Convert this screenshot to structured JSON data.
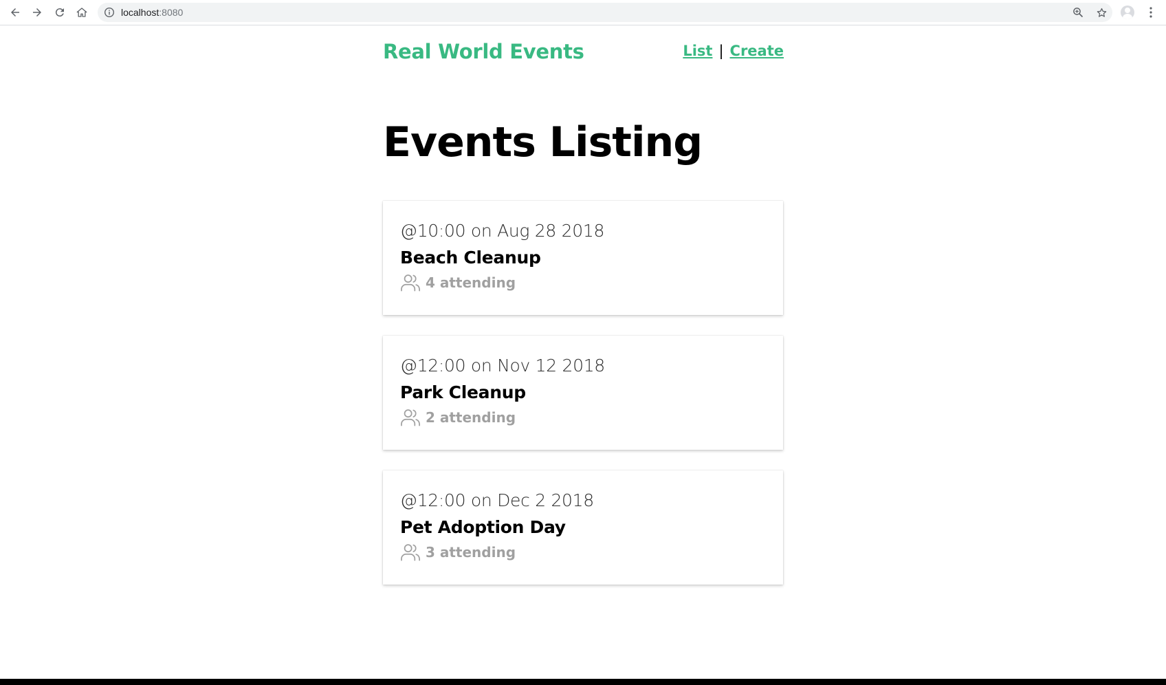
{
  "browser": {
    "url_host": "localhost",
    "url_port": ":8080"
  },
  "header": {
    "brand": "Real World Events",
    "nav": {
      "list_label": "List",
      "separator": "|",
      "create_label": "Create"
    }
  },
  "main": {
    "title": "Events Listing",
    "events": [
      {
        "when": "@10:00 on Aug 28 2018",
        "title": "Beach Cleanup",
        "attending": "4 attending"
      },
      {
        "when": "@12:00 on Nov 12 2018",
        "title": "Park Cleanup",
        "attending": "2 attending"
      },
      {
        "when": "@12:00 on Dec 2 2018",
        "title": "Pet Adoption Day",
        "attending": "3 attending"
      }
    ]
  },
  "colors": {
    "brand": "#39b982",
    "muted": "#a0a0a0"
  },
  "icons": {
    "attending": "users-icon"
  }
}
